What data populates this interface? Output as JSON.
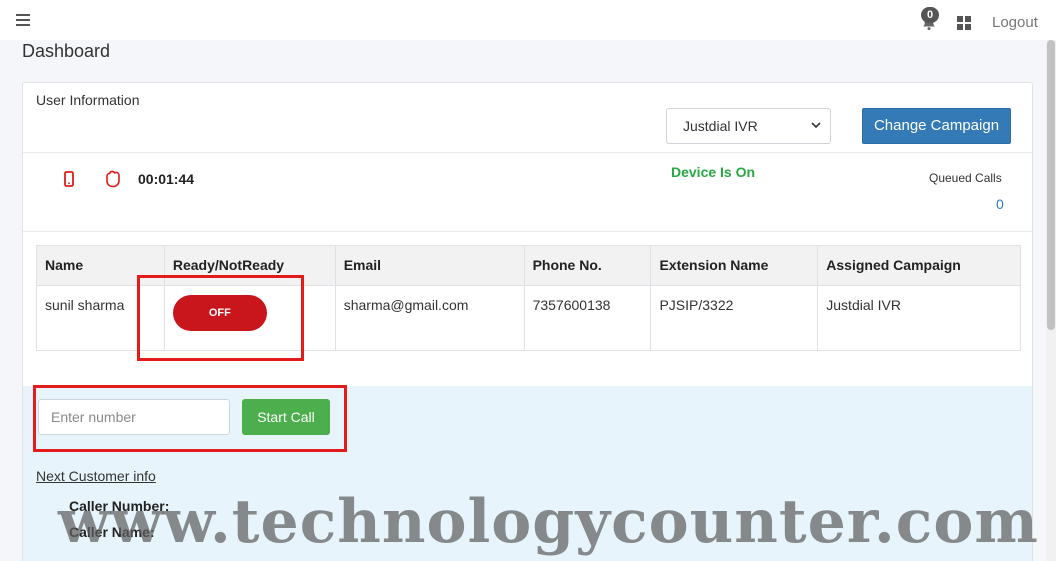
{
  "topbar": {
    "notification_count": "0",
    "logout_label": "Logout"
  },
  "page": {
    "title": "Dashboard"
  },
  "user_info": {
    "title": "User Information",
    "campaign_select": {
      "selected": "Justdial IVR"
    },
    "change_campaign_label": "Change Campaign",
    "timer": "00:01:44",
    "device_status": "Device Is On",
    "queued_calls_label": "Queued Calls",
    "queued_calls_value": "0"
  },
  "table": {
    "headers": [
      "Name",
      "Ready/NotReady",
      "Email",
      "Phone No.",
      "Extension Name",
      "Assigned Campaign"
    ],
    "row": {
      "name": "sunil sharma",
      "ready_toggle": "OFF",
      "email": "sharma@gmail.com",
      "phone": "7357600138",
      "extension": "PJSIP/3322",
      "campaign": "Justdial IVR"
    }
  },
  "dialer": {
    "number_placeholder": "Enter number",
    "start_call_label": "Start Call",
    "next_customer_label": "Next Customer info",
    "caller_number_label": "Caller Number:",
    "caller_name_label": "Caller Name:"
  },
  "watermark": "www.technologycounter.com",
  "colors": {
    "primary": "#337ab7",
    "success": "#4cae4c",
    "device_on": "#28a745",
    "toggle_off": "#c9161d",
    "highlight": "#e31b1b",
    "call_area_bg": "#e8f4fb"
  }
}
